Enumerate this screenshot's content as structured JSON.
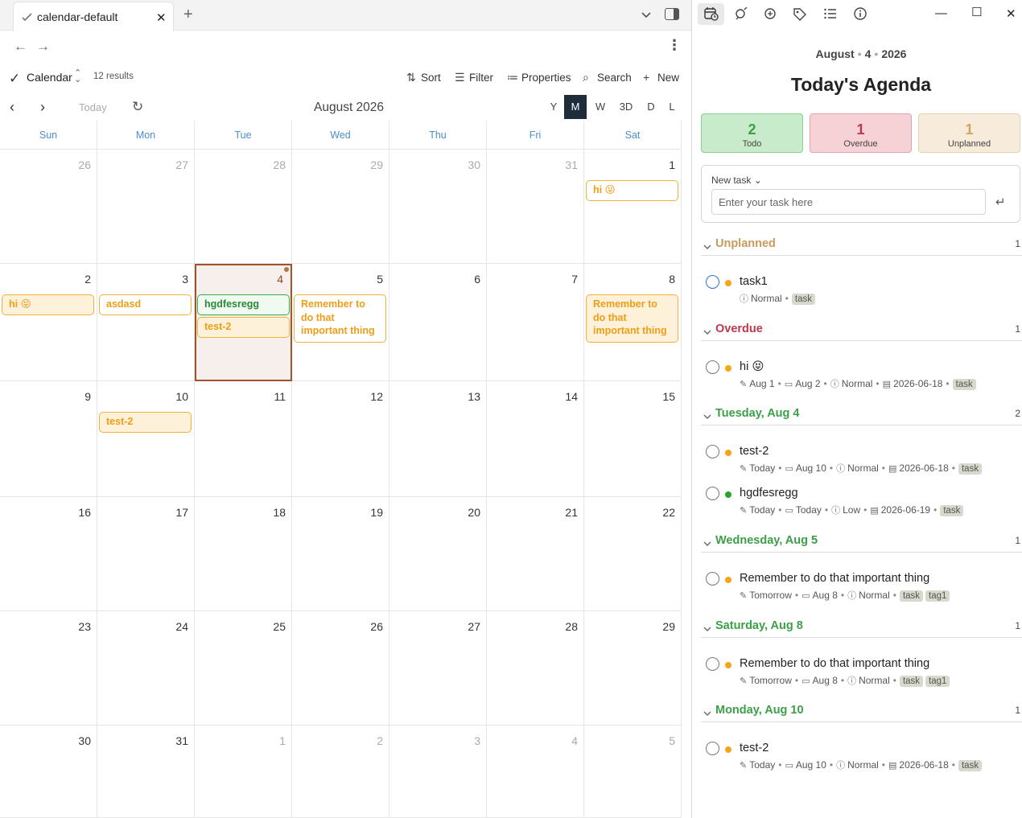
{
  "tab": {
    "title": "calendar-default"
  },
  "view": {
    "name": "Calendar",
    "results": "12 results"
  },
  "toolbar": {
    "sort": "Sort",
    "filter": "Filter",
    "properties": "Properties",
    "search": "Search",
    "new": "New"
  },
  "calendar": {
    "today_label": "Today",
    "month_title": "August 2026",
    "modes": [
      "Y",
      "M",
      "W",
      "3D",
      "D",
      "L"
    ],
    "active_mode": "M",
    "weekdays": [
      "Sun",
      "Mon",
      "Tue",
      "Wed",
      "Thu",
      "Fri",
      "Sat"
    ],
    "weeks": [
      [
        {
          "d": "26",
          "o": true
        },
        {
          "d": "27",
          "o": true
        },
        {
          "d": "28",
          "o": true
        },
        {
          "d": "29",
          "o": true
        },
        {
          "d": "30",
          "o": true
        },
        {
          "d": "31",
          "o": true
        },
        {
          "d": "1"
        }
      ],
      [
        {
          "d": "2"
        },
        {
          "d": "3"
        },
        {
          "d": "4",
          "today": true
        },
        {
          "d": "5"
        },
        {
          "d": "6"
        },
        {
          "d": "7"
        },
        {
          "d": "8"
        }
      ],
      [
        {
          "d": "9"
        },
        {
          "d": "10"
        },
        {
          "d": "11"
        },
        {
          "d": "12"
        },
        {
          "d": "13"
        },
        {
          "d": "14"
        },
        {
          "d": "15"
        }
      ],
      [
        {
          "d": "16"
        },
        {
          "d": "17"
        },
        {
          "d": "18"
        },
        {
          "d": "19"
        },
        {
          "d": "20"
        },
        {
          "d": "21"
        },
        {
          "d": "22"
        }
      ],
      [
        {
          "d": "23"
        },
        {
          "d": "24"
        },
        {
          "d": "25"
        },
        {
          "d": "26"
        },
        {
          "d": "27"
        },
        {
          "d": "28"
        },
        {
          "d": "29"
        }
      ],
      [
        {
          "d": "30"
        },
        {
          "d": "31"
        },
        {
          "d": "1",
          "o": true
        },
        {
          "d": "2",
          "o": true
        },
        {
          "d": "3",
          "o": true
        },
        {
          "d": "4",
          "o": true
        },
        {
          "d": "5",
          "o": true
        }
      ]
    ],
    "events": [
      {
        "week": 0,
        "col": 6,
        "slot": 0,
        "lines": 1,
        "text": "hi 😝",
        "style": "orange"
      },
      {
        "week": 1,
        "col": 0,
        "slot": 0,
        "lines": 1,
        "text": "hi 😝",
        "style": "orange-fill"
      },
      {
        "week": 1,
        "col": 1,
        "slot": 0,
        "lines": 1,
        "text": "asdasd",
        "style": "orange"
      },
      {
        "week": 1,
        "col": 2,
        "slot": 0,
        "lines": 1,
        "text": "hgdfesregg",
        "style": "green"
      },
      {
        "week": 1,
        "col": 2,
        "slot": 1,
        "lines": 1,
        "text": "test-2",
        "style": "orange-fill"
      },
      {
        "week": 1,
        "col": 3,
        "slot": 0,
        "lines": 3,
        "text": "Remember to do that important thing",
        "style": "orange"
      },
      {
        "week": 1,
        "col": 6,
        "slot": 0,
        "lines": 3,
        "text": "Remember to do that important thing",
        "style": "orange-fill"
      },
      {
        "week": 2,
        "col": 1,
        "slot": 0,
        "lines": 1,
        "text": "test-2",
        "style": "orange-fill"
      }
    ]
  },
  "agenda": {
    "date": {
      "month": "August",
      "day": "4",
      "year": "2026"
    },
    "title": "Today's Agenda",
    "stats": {
      "todo": {
        "n": "2",
        "label": "Todo"
      },
      "overdue": {
        "n": "1",
        "label": "Overdue"
      },
      "unplanned": {
        "n": "1",
        "label": "Unplanned"
      }
    },
    "new_task": {
      "label": "New task",
      "placeholder": "Enter your task here"
    },
    "sections": [
      {
        "title": "Unplanned",
        "count": "1",
        "color": "unpl",
        "tasks": [
          {
            "title": "task1",
            "pri": "orange",
            "check": "blue",
            "meta": [
              [
                "alert",
                "Normal"
              ]
            ],
            "tags": [
              "task"
            ]
          }
        ]
      },
      {
        "title": "Overdue",
        "count": "1",
        "color": "over",
        "tasks": [
          {
            "title": "hi 😝",
            "pri": "orange",
            "meta": [
              [
                "edit",
                "Aug 1"
              ],
              [
                "cal",
                "Aug 2"
              ],
              [
                "alert",
                "Normal"
              ],
              [
                "doc",
                "2026-06-18"
              ]
            ],
            "tags": [
              "task"
            ]
          }
        ]
      },
      {
        "title": "Tuesday, Aug 4",
        "count": "2",
        "color": "green",
        "tasks": [
          {
            "title": "test-2",
            "pri": "orange",
            "meta": [
              [
                "edit",
                "Today"
              ],
              [
                "cal",
                "Aug 10"
              ],
              [
                "alert",
                "Normal"
              ],
              [
                "doc",
                "2026-06-18"
              ]
            ],
            "tags": [
              "task"
            ]
          },
          {
            "title": "hgdfesregg",
            "pri": "green",
            "meta": [
              [
                "edit",
                "Today"
              ],
              [
                "cal",
                "Today"
              ],
              [
                "alert",
                "Low"
              ],
              [
                "doc",
                "2026-06-19"
              ]
            ],
            "tags": [
              "task"
            ]
          }
        ]
      },
      {
        "title": "Wednesday, Aug 5",
        "count": "1",
        "color": "green",
        "tasks": [
          {
            "title": "Remember to do that important thing",
            "pri": "orange",
            "meta": [
              [
                "edit",
                "Tomorrow"
              ],
              [
                "cal",
                "Aug 8"
              ],
              [
                "alert",
                "Normal"
              ]
            ],
            "tags": [
              "task",
              "tag1"
            ]
          }
        ]
      },
      {
        "title": "Saturday, Aug 8",
        "count": "1",
        "color": "green",
        "tasks": [
          {
            "title": "Remember to do that important thing",
            "pri": "orange",
            "meta": [
              [
                "edit",
                "Tomorrow"
              ],
              [
                "cal",
                "Aug 8"
              ],
              [
                "alert",
                "Normal"
              ]
            ],
            "tags": [
              "task",
              "tag1"
            ]
          }
        ]
      },
      {
        "title": "Monday, Aug 10",
        "count": "1",
        "color": "green",
        "tasks": [
          {
            "title": "test-2",
            "pri": "orange",
            "meta": [
              [
                "edit",
                "Today"
              ],
              [
                "cal",
                "Aug 10"
              ],
              [
                "alert",
                "Normal"
              ],
              [
                "doc",
                "2026-06-18"
              ]
            ],
            "tags": [
              "task"
            ]
          }
        ]
      }
    ]
  },
  "colors": {
    "accent_dark": "#1f2d3a",
    "today_border": "#a0532a",
    "orange": "#ef9d15",
    "green": "#3c9f47",
    "red": "#c0384e",
    "weekday_blue": "#4a8fd1"
  },
  "icons": [
    "checkmark-icon",
    "close-icon",
    "plus-icon",
    "chevron-down-icon",
    "sidebar-toggle-icon",
    "arrow-left-icon",
    "arrow-right-icon",
    "more-vertical-icon",
    "sort-icon",
    "filter-icon",
    "list-icon",
    "search-icon",
    "refresh-icon",
    "calendar-clock-icon",
    "tag-icon",
    "info-icon",
    "minimize-icon",
    "maximize-icon",
    "enter-icon"
  ]
}
